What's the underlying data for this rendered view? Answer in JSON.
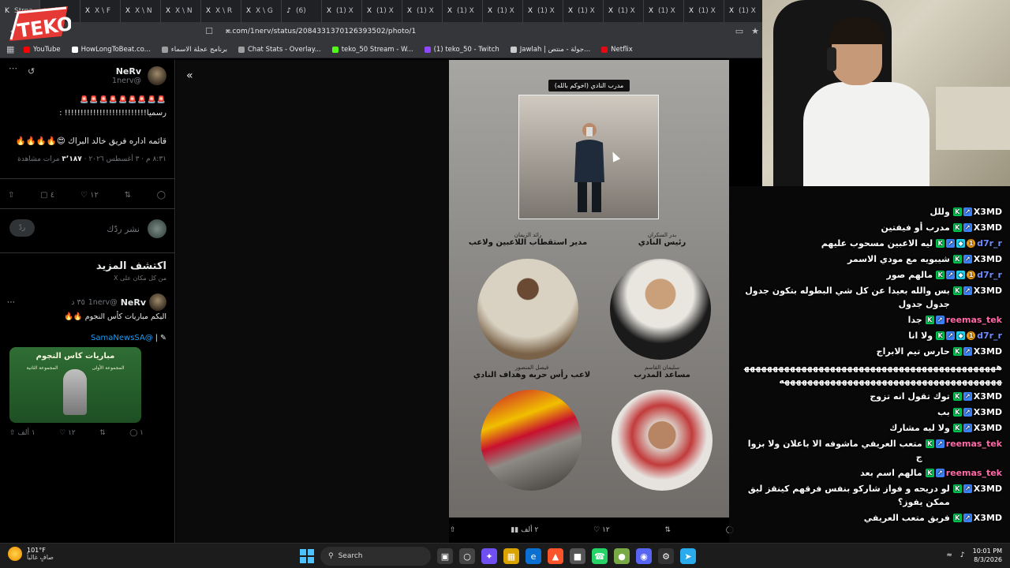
{
  "browser": {
    "tabs": [
      {
        "icon": "K",
        "label": "Strea"
      },
      {
        "icon": "▶",
        "label": "(8)"
      },
      {
        "icon": "X",
        "label": "X \\ F"
      },
      {
        "icon": "X",
        "label": "X \\ N"
      },
      {
        "icon": "X",
        "label": "X \\ N"
      },
      {
        "icon": "X",
        "label": "X \\ R"
      },
      {
        "icon": "X",
        "label": "X \\ G"
      },
      {
        "icon": "♪",
        "label": "(6)"
      },
      {
        "icon": "X",
        "label": "(1) X"
      },
      {
        "icon": "X",
        "label": "(1) X"
      },
      {
        "icon": "X",
        "label": "(1) X"
      },
      {
        "icon": "X",
        "label": "(1) X"
      },
      {
        "icon": "X",
        "label": "(1) X"
      },
      {
        "icon": "X",
        "label": "(1) X"
      },
      {
        "icon": "X",
        "label": "(1) X"
      },
      {
        "icon": "X",
        "label": "(1) X"
      },
      {
        "icon": "X",
        "label": "(1) X"
      },
      {
        "icon": "X",
        "label": "(1) X"
      },
      {
        "icon": "X",
        "label": "(1) X"
      }
    ],
    "url": "x.com/1nerv/status/2084331370126393502/photo/1",
    "bookmarks": [
      {
        "label": "YouTube",
        "color": "#ff0000"
      },
      {
        "label": "HowLongToBeat.co...",
        "color": "#ffffff"
      },
      {
        "label": "برنامج عجلة الاسماء",
        "color": "#9e9e9e"
      },
      {
        "label": "Chat Stats - Overlay...",
        "color": "#9e9e9e"
      },
      {
        "label": "teko_50 Stream - W...",
        "color": "#53fc18"
      },
      {
        "label": "(1) teko_50 - Twitch",
        "color": "#9146ff"
      },
      {
        "label": "Jawlah | جولة - منتص...",
        "color": "#cccccc"
      },
      {
        "label": "Netflix",
        "color": "#e50914"
      }
    ]
  },
  "logo_text": "TEKO",
  "tweet": {
    "name": "NeRv",
    "handle": "@1nerv",
    "emoji_row": "🚨🚨🚨🚨🚨🚨🚨🚨🚨",
    "line1": "رسميا!!!!!!!!!!!!!!!!!!!!!!!!!! :",
    "line2": "قائمه اداره فريق خالد البراك 😍🔥🔥🔥🔥",
    "time": "٨:٣١ م · ٣ أغسطس ٢٠٢٦ ·",
    "views": "٣٬١٨٧",
    "views_label": "مرات مشاهدة",
    "likes": "١٢",
    "bookmarks": "٤",
    "reply_placeholder": "نشر ردّك",
    "reply_button": "ردّ"
  },
  "discover": {
    "title": "اكتشف المزيد",
    "subtitle": "من كل مكان على X"
  },
  "tweet2": {
    "name": "NeRv",
    "handle": "@1nerv",
    "time": "٣٥ د",
    "text": "اليكم مباريات كأس النجوم 🔥🔥",
    "mention": "@SamaNewsSA",
    "card_title": "مباريات كاس النجوم",
    "group1": "المجموعة الأولى",
    "group2": "المجموعة الثانية",
    "replies": "١",
    "likes": "١٢",
    "views": "١ ألف"
  },
  "photo": {
    "title": "مدرب النادي (اخوكم بالله)",
    "roles": [
      {
        "name": "بدر السكران",
        "role": "رئيس النادي"
      },
      {
        "name": "رائد الزيمان",
        "role": "مدير استقطاب اللاعبين ولاعب"
      },
      {
        "name": "سليمان القاسم",
        "role": "مساعد المدرب"
      },
      {
        "name": "فيصل المنصور",
        "role": "لاعب رأس حربه وهداف النادي"
      }
    ],
    "bottom_views": "٢ ألف",
    "bottom_likes": "١٢"
  },
  "chat": [
    {
      "user": "X3MD",
      "color": "white",
      "badges": [
        "green",
        "blue"
      ],
      "text": "وللل"
    },
    {
      "user": "X3MD",
      "color": "white",
      "badges": [
        "green",
        "blue"
      ],
      "text": "مدرب أو فيفتين"
    },
    {
      "user": "d7r_r",
      "color": "blue",
      "badges": [
        "green",
        "blue",
        "cyan",
        "gold"
      ],
      "text": "ليه الاعبين مسحوب عليهم"
    },
    {
      "user": "X3MD",
      "color": "white",
      "badges": [
        "green",
        "blue"
      ],
      "text": "شيبويه مع مودي الاسمر"
    },
    {
      "user": "d7r_r",
      "color": "blue",
      "badges": [
        "green",
        "blue",
        "cyan",
        "gold"
      ],
      "text": "مالهم صور"
    },
    {
      "user": "X3MD",
      "color": "white",
      "badges": [
        "green",
        "blue"
      ],
      "text": "بس والله بعيدا عن كل شي البطوله بتكون جدول جدول جدول"
    },
    {
      "user": "reemas_tek",
      "color": "pink",
      "badges": [
        "green",
        "blue"
      ],
      "text": "جدا"
    },
    {
      "user": "d7r_r",
      "color": "blue",
      "badges": [
        "green",
        "blue",
        "cyan",
        "gold"
      ],
      "text": "ولا انا"
    },
    {
      "user": "X3MD",
      "color": "white",
      "badges": [
        "green",
        "blue"
      ],
      "text": "حارس تيم الابراج"
    },
    {
      "user": "",
      "color": "white",
      "badges": [],
      "text": "هههههههههههههههههههههههههههههههههههههههههههههههههههههههههههههههههههههههههههههههههههه"
    },
    {
      "user": "X3MD",
      "color": "white",
      "badges": [
        "green",
        "blue"
      ],
      "text": "توك تقول انه تزوج"
    },
    {
      "user": "X3MD",
      "color": "white",
      "badges": [
        "green",
        "blue"
      ],
      "text": "بب"
    },
    {
      "user": "X3MD",
      "color": "white",
      "badges": [
        "green",
        "blue"
      ],
      "text": "ولا ليه مشارك"
    },
    {
      "user": "reemas_tek",
      "color": "pink",
      "badges": [
        "green",
        "blue"
      ],
      "text": "متعب العريفي ماشوفه الا باعلان ولا بزواج"
    },
    {
      "user": "reemas_tek",
      "color": "pink",
      "badges": [
        "green",
        "blue"
      ],
      "text": "مالهم اسم بعد"
    },
    {
      "user": "X3MD",
      "color": "white",
      "badges": [
        "green",
        "blue"
      ],
      "text": "لو دريحه و فواز شاركو بنفس فرقهم كينقز ليق ممكن يفوز؟"
    },
    {
      "user": "X3MD",
      "color": "white",
      "badges": [
        "green",
        "blue"
      ],
      "text": "فريق متعب العريفي"
    }
  ],
  "taskbar": {
    "temp": "101°F",
    "weather": "صافٍ غالباً",
    "search": "Search",
    "time": "10:01 PM",
    "date": "8/3/2026"
  }
}
